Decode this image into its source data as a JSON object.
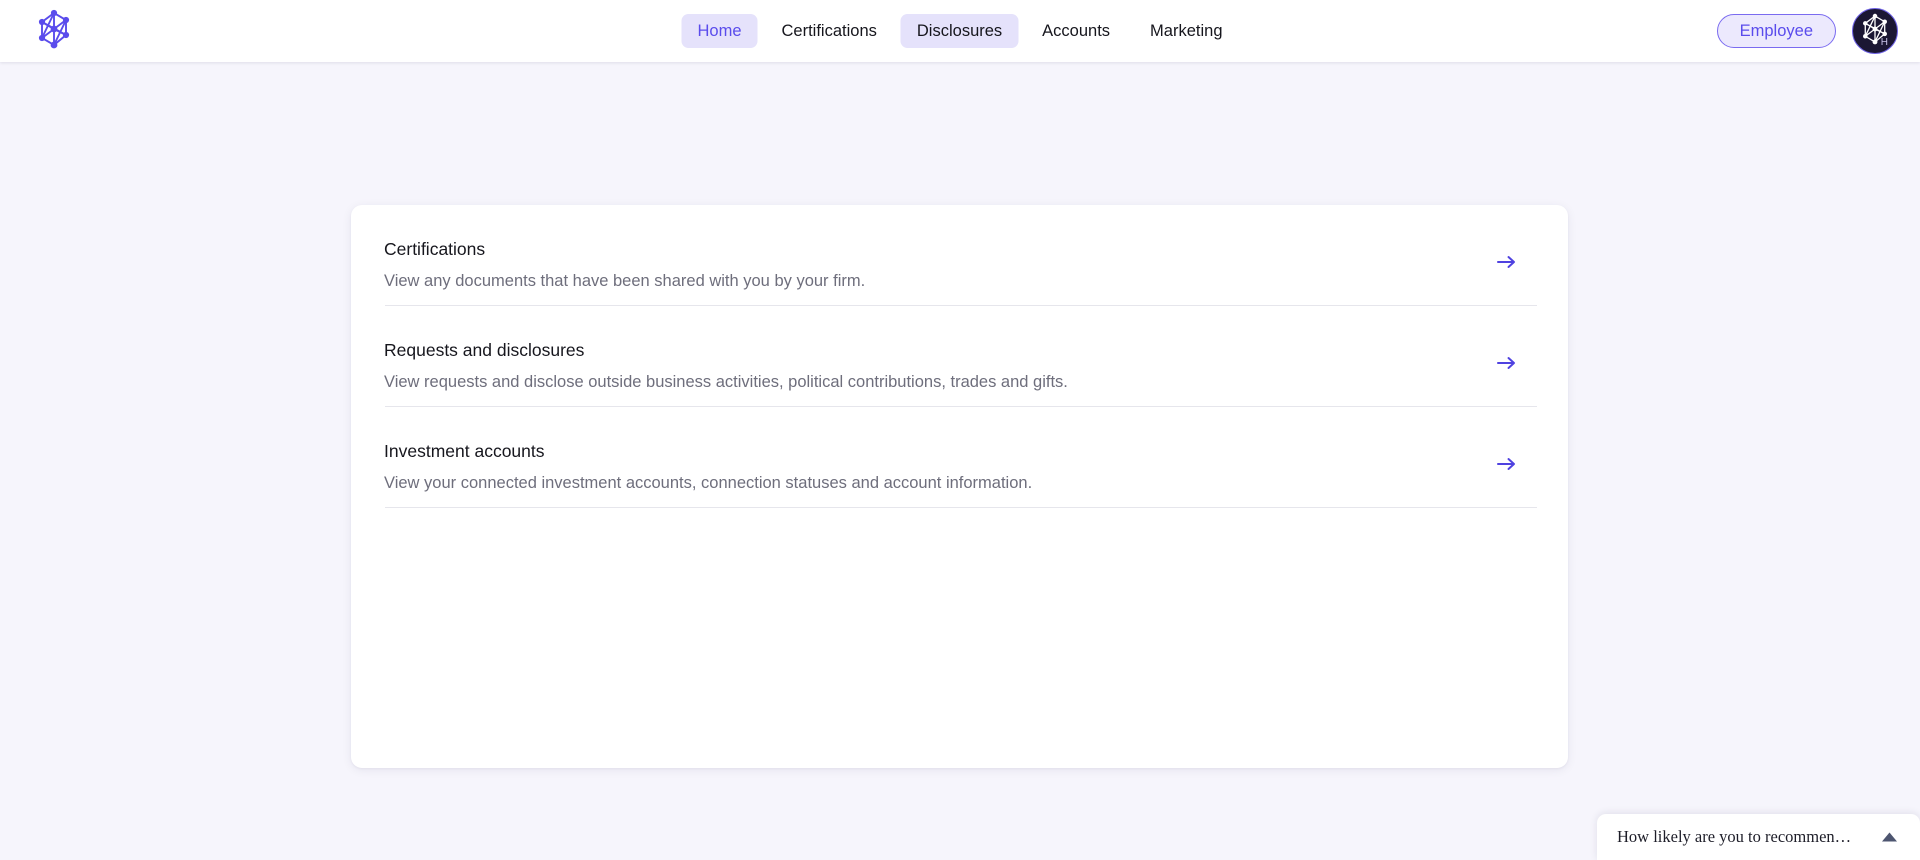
{
  "header": {
    "logo_icon": "network-graph-logo",
    "nav": [
      {
        "label": "Home",
        "state": "active"
      },
      {
        "label": "Certifications",
        "state": "default"
      },
      {
        "label": "Disclosures",
        "state": "hover"
      },
      {
        "label": "Accounts",
        "state": "default"
      },
      {
        "label": "Marketing",
        "state": "default"
      }
    ],
    "role_pill": "Employee",
    "avatar": {
      "icon": "network-graph-avatar",
      "badge": "H"
    }
  },
  "main": {
    "rows": [
      {
        "title": "Certifications",
        "description": "View any documents that have been shared with you by your firm.",
        "arrow_icon": "arrow-right-icon"
      },
      {
        "title": "Requests and disclosures",
        "description": "View requests and disclose outside business activities, political contributions, trades and gifts.",
        "arrow_icon": "arrow-right-icon"
      },
      {
        "title": "Investment accounts",
        "description": "View your connected investment accounts, connection statuses and account information.",
        "arrow_icon": "arrow-right-icon"
      }
    ]
  },
  "survey": {
    "text": "How likely are you to recommen…",
    "caret_icon": "caret-up-icon"
  },
  "colors": {
    "accent": "#5a4cec",
    "accent_soft": "#e5e2fb",
    "page_background": "#f6f5fc",
    "card_background": "#ffffff",
    "title_text": "#16161d",
    "muted_text": "#6e6e7c",
    "divider": "#e6e6ec",
    "avatar_background": "#1b1733"
  }
}
